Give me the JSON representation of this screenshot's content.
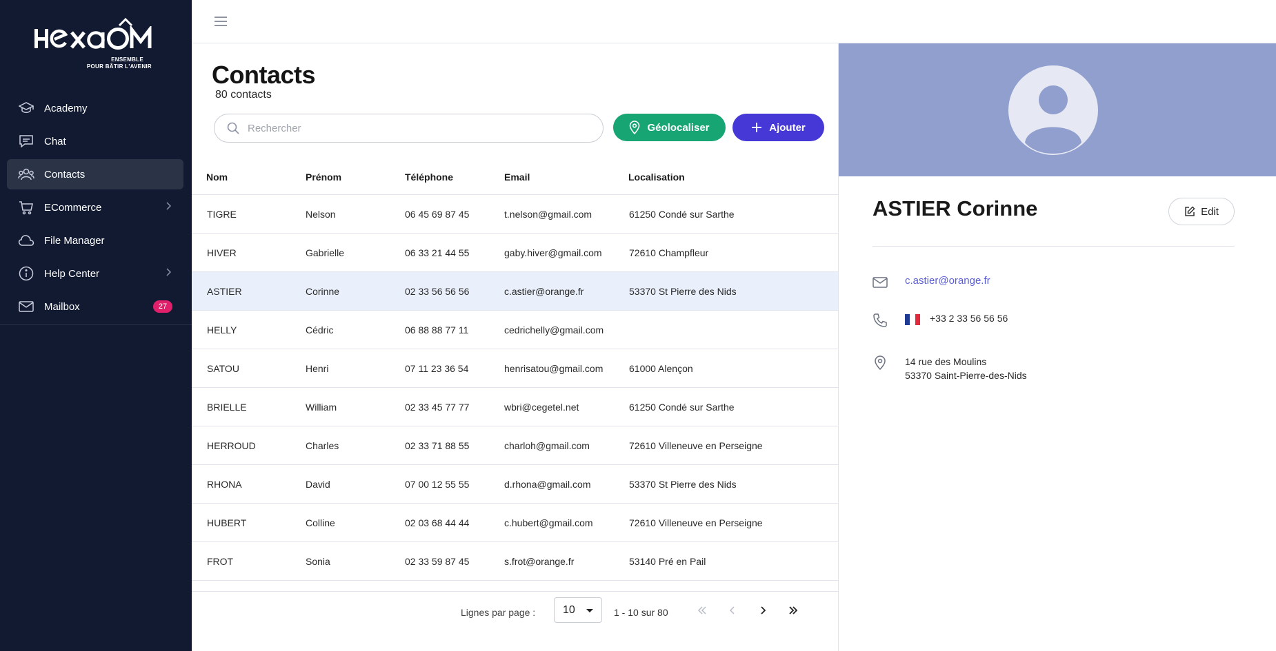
{
  "brand": {
    "name": "Hexaôm",
    "word": "HEXAOM",
    "tagline1": "ENSEMBLE",
    "tagline2": "POUR BÂTIR L'AVENIR"
  },
  "sidebar": {
    "items": [
      {
        "label": "Academy",
        "icon": "graduation-cap-icon"
      },
      {
        "label": "Chat",
        "icon": "chat-icon"
      },
      {
        "label": "Contacts",
        "icon": "users-icon",
        "active": true
      },
      {
        "label": "ECommerce",
        "icon": "cart-icon",
        "has_submenu": true
      },
      {
        "label": "File Manager",
        "icon": "cloud-icon"
      },
      {
        "label": "Help Center",
        "icon": "info-icon",
        "has_submenu": true
      },
      {
        "label": "Mailbox",
        "icon": "mail-icon",
        "badge": "27"
      }
    ]
  },
  "main": {
    "title": "Contacts",
    "count": "80 contacts",
    "search_placeholder": "Rechercher",
    "geo_label": "Géolocaliser",
    "add_label": "Ajouter",
    "columns": [
      "Nom",
      "Prénom",
      "Téléphone",
      "Email",
      "Localisation"
    ],
    "rows": [
      {
        "nom": "TIGRE",
        "prenom": "Nelson",
        "tel": "06 45 69 87 45",
        "email": "t.nelson@gmail.com",
        "loc": "61250 Condé sur Sarthe"
      },
      {
        "nom": "HIVER",
        "prenom": "Gabrielle",
        "tel": "06 33 21 44 55",
        "email": "gaby.hiver@gmail.com",
        "loc": "72610 Champfleur"
      },
      {
        "nom": "ASTIER",
        "prenom": "Corinne",
        "tel": "02 33 56 56 56",
        "email": "c.astier@orange.fr",
        "loc": "53370 St Pierre des Nids",
        "selected": true
      },
      {
        "nom": "HELLY",
        "prenom": "Cédric",
        "tel": "06 88 88 77 11",
        "email": "cedrichelly@gmail.com",
        "loc": ""
      },
      {
        "nom": "SATOU",
        "prenom": "Henri",
        "tel": "07 11 23 36 54",
        "email": "henrisatou@gmail.com",
        "loc": "61000 Alençon"
      },
      {
        "nom": "BRIELLE",
        "prenom": "William",
        "tel": "02 33 45 77 77",
        "email": "wbri@cegetel.net",
        "loc": "61250 Condé sur Sarthe"
      },
      {
        "nom": "HERROUD",
        "prenom": "Charles",
        "tel": "02 33 71 88 55",
        "email": "charloh@gmail.com",
        "loc": "72610 Villeneuve en Perseigne"
      },
      {
        "nom": "RHONA",
        "prenom": "David",
        "tel": "07 00 12 55 55",
        "email": "d.rhona@gmail.com",
        "loc": "53370 St Pierre des Nids"
      },
      {
        "nom": "HUBERT",
        "prenom": "Colline",
        "tel": "02 03 68 44 44",
        "email": "c.hubert@gmail.com",
        "loc": "72610 Villeneuve en Perseigne"
      },
      {
        "nom": "FROT",
        "prenom": "Sonia",
        "tel": "02 33 59 87 45",
        "email": "s.frot@orange.fr",
        "loc": "53140 Pré en Pail"
      }
    ],
    "pager": {
      "rows_label": "Lignes par page :",
      "page_size": "10",
      "range": "1 - 10  sur 80"
    }
  },
  "detail": {
    "name": "ASTIER Corinne",
    "edit_label": "Edit",
    "email": "c.astier@orange.fr",
    "phone": "+33 2 33 56 56 56",
    "address_line1": "14 rue des Moulins",
    "address_line2": "53370 Saint-Pierre-des-Nids"
  },
  "colors": {
    "sidebar_bg": "#111a31",
    "active_nav_bg": "#2b3347",
    "badge": "#e0206a",
    "geo_button": "#17a673",
    "add_button": "#4638d6",
    "cover": "#919fce",
    "selected_row": "#eaf0fb",
    "email_link": "#5a5fd6"
  }
}
